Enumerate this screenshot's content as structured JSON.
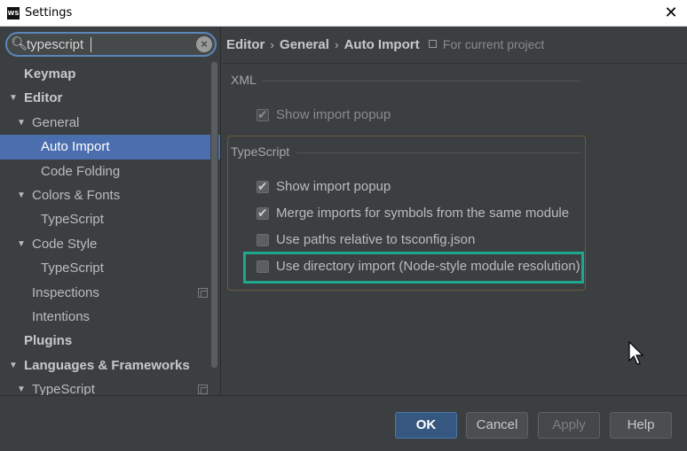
{
  "window": {
    "app_icon_text": "WS",
    "title": "Settings",
    "close_glyph": "✕"
  },
  "search": {
    "value": "typescript",
    "icon": "search-icon",
    "clear_icon": "clear-icon"
  },
  "tree": [
    {
      "label": "Keymap",
      "level": 0,
      "bold": true,
      "arrow": false
    },
    {
      "label": "Editor",
      "level": 0,
      "bold": true,
      "arrow": true
    },
    {
      "label": "General",
      "level": 1,
      "bold": false,
      "arrow": true
    },
    {
      "label": "Auto Import",
      "level": 2,
      "bold": false,
      "arrow": false,
      "selected": true
    },
    {
      "label": "Code Folding",
      "level": 2,
      "bold": false,
      "arrow": false
    },
    {
      "label": "Colors & Fonts",
      "level": 1,
      "bold": false,
      "arrow": true
    },
    {
      "label": "TypeScript",
      "level": 2,
      "bold": false,
      "arrow": false
    },
    {
      "label": "Code Style",
      "level": 1,
      "bold": false,
      "arrow": true
    },
    {
      "label": "TypeScript",
      "level": 2,
      "bold": false,
      "arrow": false
    },
    {
      "label": "Inspections",
      "level": 1,
      "bold": false,
      "arrow": false,
      "project_icon": true
    },
    {
      "label": "Intentions",
      "level": 1,
      "bold": false,
      "arrow": false
    },
    {
      "label": "Plugins",
      "level": 0,
      "bold": true,
      "arrow": false
    },
    {
      "label": "Languages & Frameworks",
      "level": 0,
      "bold": true,
      "arrow": true
    },
    {
      "label": "TypeScript",
      "level": 1,
      "bold": false,
      "arrow": true,
      "project_icon": true
    }
  ],
  "breadcrumb": {
    "items": [
      "Editor",
      "General",
      "Auto Import"
    ],
    "separator": "›",
    "scope": "For current project"
  },
  "xml": {
    "title": "XML",
    "show_import_popup": {
      "label": "Show import popup",
      "checked": true,
      "enabled": false
    }
  },
  "typescript": {
    "title": "TypeScript",
    "options": [
      {
        "label": "Show import popup",
        "checked": true
      },
      {
        "label": "Merge imports for symbols from the same module",
        "checked": true
      },
      {
        "label": "Use paths relative to tsconfig.json",
        "checked": false
      },
      {
        "label": "Use directory import (Node-style module resolution)",
        "checked": false,
        "highlighted": true
      }
    ]
  },
  "buttons": {
    "ok": "OK",
    "cancel": "Cancel",
    "apply": "Apply",
    "help": "Help"
  },
  "colors": {
    "background": "#3c3f41",
    "selection": "#4b6eaf",
    "highlight_box": "#1fa68e",
    "ok_button": "#365880"
  }
}
